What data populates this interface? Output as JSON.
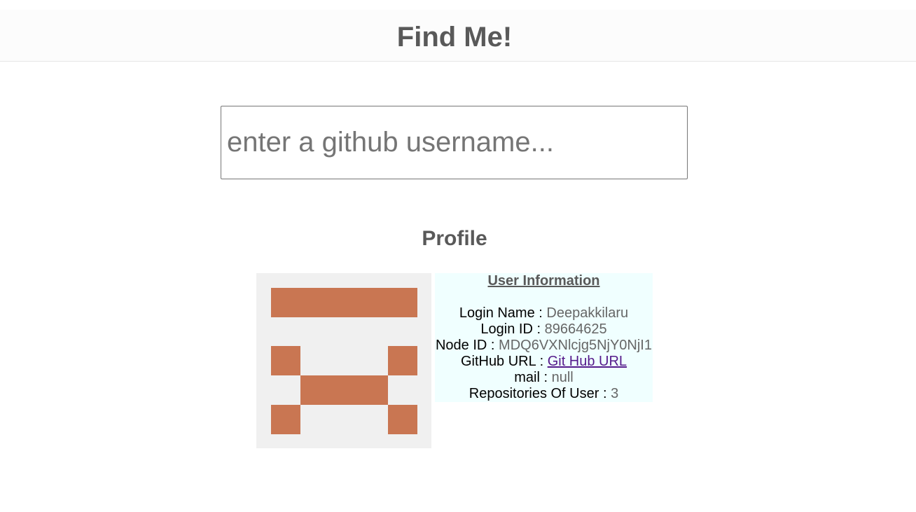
{
  "header": {
    "title": "Find Me!"
  },
  "search": {
    "placeholder": "enter a github username...",
    "value": ""
  },
  "profile": {
    "title": "Profile",
    "avatar": {
      "pixel_color": "#c97652",
      "background": "#f0f0f0"
    },
    "info": {
      "heading": "User Information",
      "login_name_label": "Login Name : ",
      "login_name": "Deepakkilaru",
      "login_id_label": "Login ID : ",
      "login_id": "89664625",
      "node_id_label": "Node ID : ",
      "node_id": "MDQ6VXNlcjg5NjY0NjI1",
      "github_url_label": "GitHub URL : ",
      "github_url_text": "Git Hub URL",
      "mail_label": "mail : ",
      "mail": "null",
      "repos_label": "Repositories Of User : ",
      "repos": "3"
    }
  }
}
